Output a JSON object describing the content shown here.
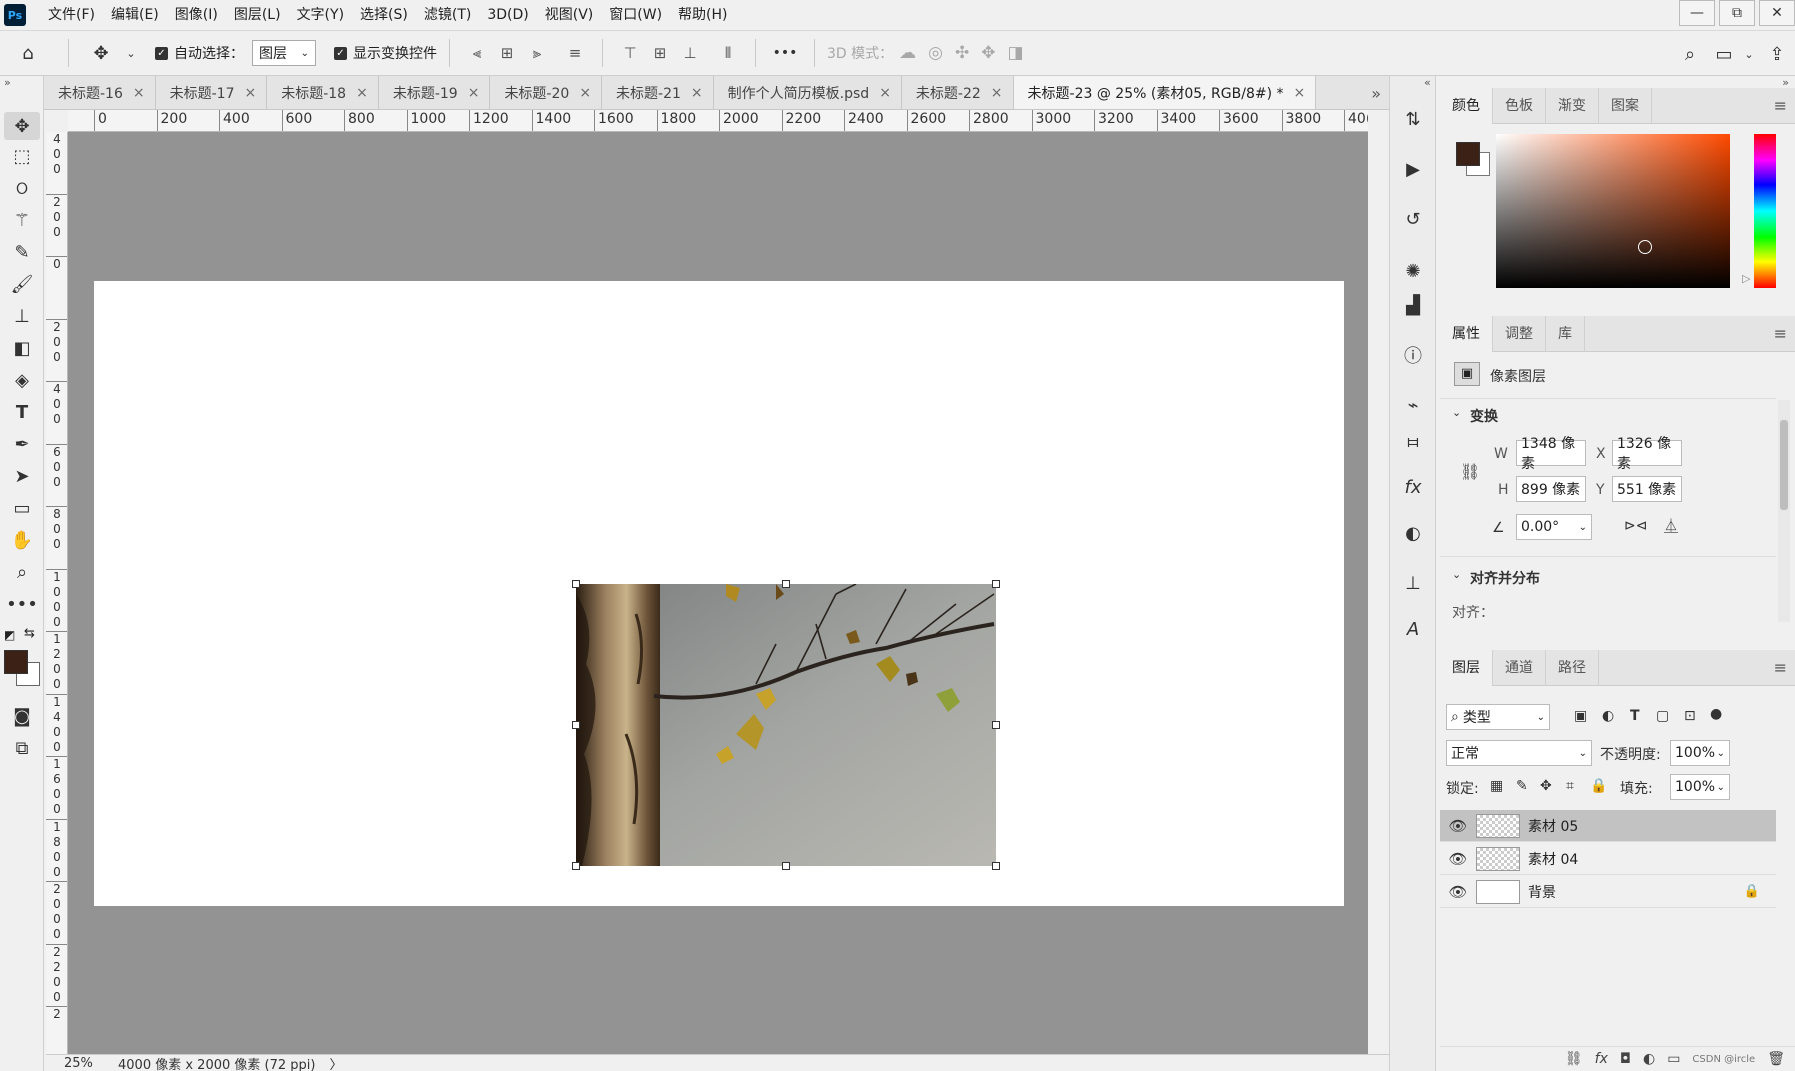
{
  "app": {
    "logo": "Ps"
  },
  "menus": [
    "文件(F)",
    "编辑(E)",
    "图像(I)",
    "图层(L)",
    "文字(Y)",
    "选择(S)",
    "滤镜(T)",
    "3D(D)",
    "视图(V)",
    "窗口(W)",
    "帮助(H)"
  ],
  "window_controls": {
    "minimize": "—",
    "restore": "⧉",
    "close": "✕"
  },
  "options": {
    "auto_select_label": "自动选择：",
    "auto_select_value": "图层",
    "show_transform_label": "显示变换控件",
    "more": "•••",
    "mode_3d_label": "3D 模式："
  },
  "tabs": [
    {
      "label": "未标题-16",
      "active": false
    },
    {
      "label": "未标题-17",
      "active": false
    },
    {
      "label": "未标题-18",
      "active": false
    },
    {
      "label": "未标题-19",
      "active": false
    },
    {
      "label": "未标题-20",
      "active": false
    },
    {
      "label": "未标题-21",
      "active": false
    },
    {
      "label": "制作个人简历模板.psd",
      "active": false
    },
    {
      "label": "未标题-22",
      "active": false
    },
    {
      "label": "未标题-23 @ 25% (素材05, RGB/8#) *",
      "active": true
    }
  ],
  "tab_close": "×",
  "ruler_h": [
    "0",
    "200",
    "400",
    "600",
    "800",
    "1000",
    "1200",
    "1400",
    "1600",
    "1800",
    "2000",
    "2200",
    "2400",
    "2600",
    "2800",
    "3000",
    "3200",
    "3400",
    "3600",
    "3800",
    "40("
  ],
  "ruler_v": [
    "400",
    "200",
    "0",
    "200",
    "400",
    "600",
    "800",
    "1000",
    "1200",
    "1400",
    "1600",
    "1800",
    "2000",
    "2200",
    "2"
  ],
  "status": {
    "zoom": "25%",
    "doc_info": "4000 像素 x 2000 像素 (72 ppi)",
    "arrow": "〉"
  },
  "colors": {
    "foreground": "#3b2116",
    "background": "#ffffff",
    "canvas_bg": "#939393",
    "selected_layer": "#c2c2c2"
  },
  "color_panel": {
    "tabs": [
      "颜色",
      "色板",
      "渐变",
      "图案"
    ]
  },
  "properties_panel": {
    "tabs": [
      "属性",
      "调整",
      "库"
    ],
    "layer_type": "像素图层",
    "transform_title": "变换",
    "w_label": "W",
    "w_value": "1348 像素",
    "x_label": "X",
    "x_value": "1326 像素",
    "h_label": "H",
    "h_value": "899 像素",
    "y_label": "Y",
    "y_value": "551 像素",
    "angle_value": "0.00°",
    "align_title": "对齐并分布",
    "align_label": "对齐："
  },
  "layers_panel": {
    "tabs": [
      "图层",
      "通道",
      "路径"
    ],
    "filter_label": "类型",
    "blend_mode": "正常",
    "opacity_label": "不透明度:",
    "opacity_value": "100%",
    "lock_label": "锁定:",
    "fill_label": "填充:",
    "fill_value": "100%",
    "layers": [
      {
        "name": "素材 05",
        "selected": true
      },
      {
        "name": "素材 04",
        "selected": false
      },
      {
        "name": "背景",
        "selected": false
      }
    ],
    "watermark": "CSDN @ircle"
  }
}
